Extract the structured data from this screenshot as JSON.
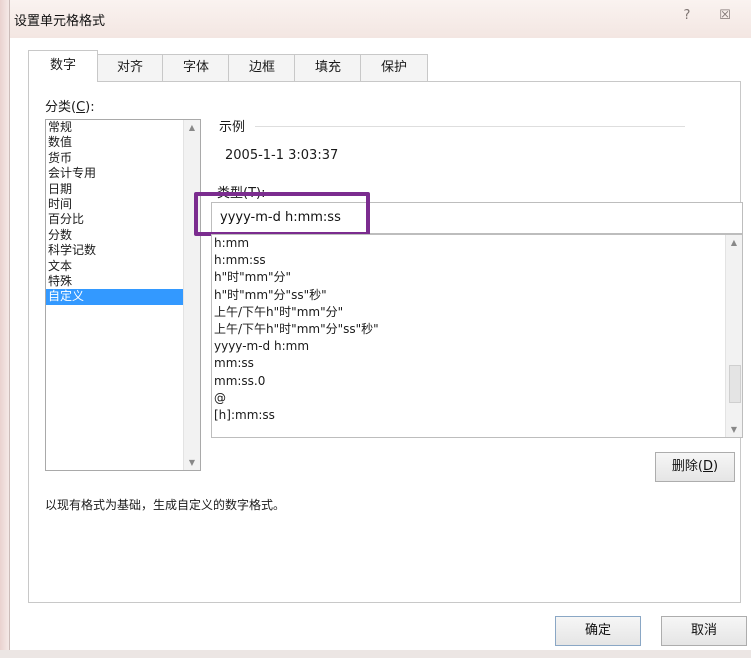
{
  "window": {
    "title": "设置单元格格式",
    "help_glyph": "?",
    "close_glyph": "☒"
  },
  "tabs": [
    "数字",
    "对齐",
    "字体",
    "边框",
    "填充",
    "保护"
  ],
  "category": {
    "label_prefix": "分类(",
    "label_key": "C",
    "label_suffix": "):",
    "items": [
      "常规",
      "数值",
      "货币",
      "会计专用",
      "日期",
      "时间",
      "百分比",
      "分数",
      "科学记数",
      "文本",
      "特殊",
      "自定义"
    ],
    "selected_index": 11
  },
  "sample": {
    "label": "示例",
    "value": "2005-1-1 3:03:37"
  },
  "type": {
    "label": "类型(T):",
    "value": "yyyy-m-d h:mm:ss"
  },
  "formats": [
    "h:mm",
    "h:mm:ss",
    "h\"时\"mm\"分\"",
    "h\"时\"mm\"分\"ss\"秒\"",
    "上午/下午h\"时\"mm\"分\"",
    "上午/下午h\"时\"mm\"分\"ss\"秒\"",
    "yyyy-m-d h:mm",
    "mm:ss",
    "mm:ss.0",
    "@",
    "[h]:mm:ss"
  ],
  "delete_button": {
    "label_prefix": "删除(",
    "label_key": "D",
    "label_suffix": ")"
  },
  "description": "以现有格式为基础，生成自定义的数字格式。",
  "footer": {
    "ok": "确定",
    "cancel": "取消"
  },
  "colors": {
    "selection": "#3399ff",
    "highlight_box": "#7b2c8f"
  }
}
